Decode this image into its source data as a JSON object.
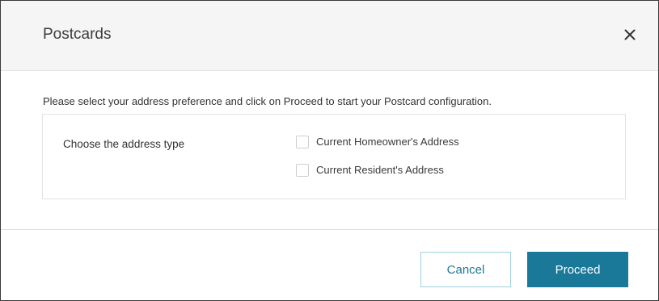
{
  "dialog": {
    "title": "Postcards",
    "close_icon": "close-icon",
    "instructions": "Please select your address preference and click on Proceed to start your Postcard configuration.",
    "choice_label": "Choose the address type",
    "options": [
      {
        "label": "Current Homeowner's Address",
        "checked": false
      },
      {
        "label": "Current Resident's Address",
        "checked": false
      }
    ],
    "buttons": {
      "cancel_label": "Cancel",
      "proceed_label": "Proceed"
    }
  },
  "colors": {
    "header_bg": "#f5f5f5",
    "primary": "#1a7899",
    "secondary_border": "#9ed0de",
    "text": "#333333"
  }
}
